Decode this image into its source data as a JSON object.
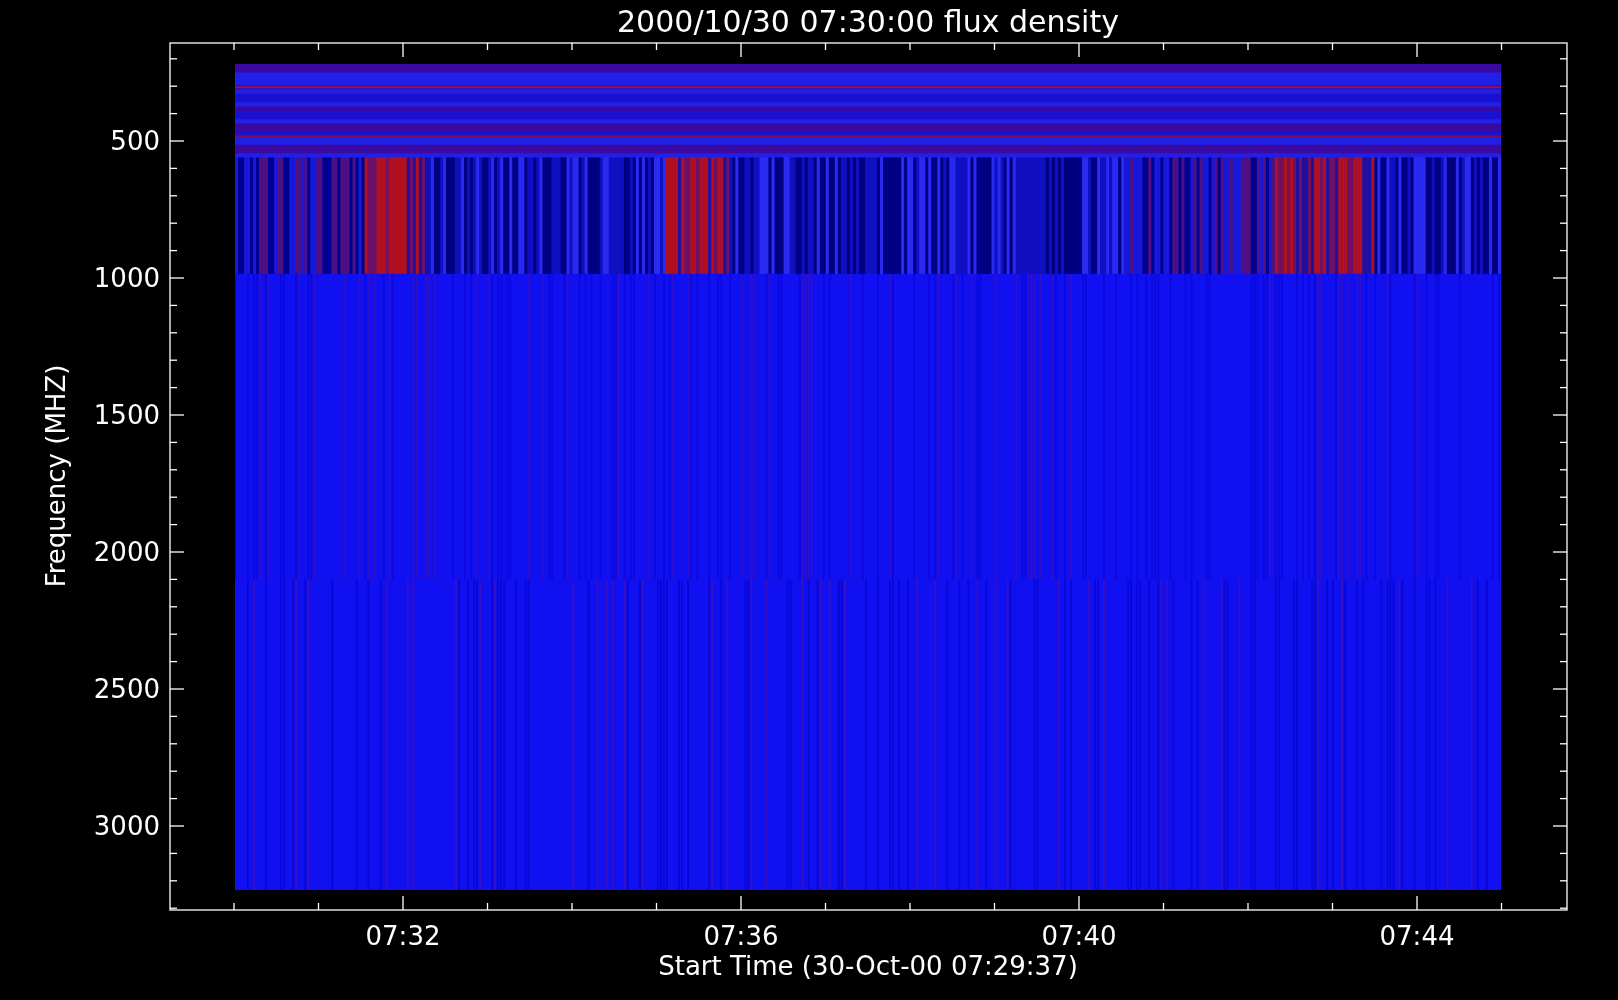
{
  "plot": {
    "title": "2000/10/30 07:30:00 flux density",
    "y_axis": {
      "label": "Frequency (MHZ)",
      "tick_labels": [
        "500",
        "1000",
        "1500",
        "2000",
        "2500",
        "3000"
      ]
    },
    "x_axis": {
      "label": "Start Time (30-Oct-00 07:29:37)",
      "tick_labels": [
        "07:32",
        "07:36",
        "07:40",
        "07:44"
      ]
    }
  }
}
